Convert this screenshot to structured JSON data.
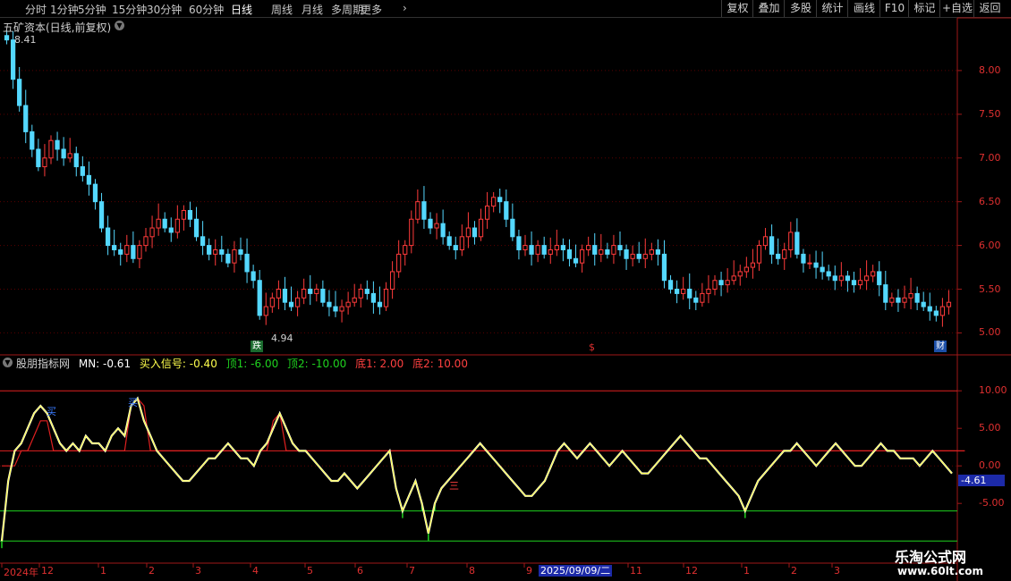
{
  "toolbar": {
    "timeframes": [
      {
        "label": "分时",
        "active": false
      },
      {
        "label": "1分钟",
        "active": false
      },
      {
        "label": "5分钟",
        "active": false
      },
      {
        "label": "15分钟",
        "active": false
      },
      {
        "label": "30分钟",
        "active": false
      },
      {
        "label": "60分钟",
        "active": false
      },
      {
        "label": "日线",
        "active": true
      },
      {
        "label": "周线",
        "active": false
      },
      {
        "label": "月线",
        "active": false
      },
      {
        "label": "多周期",
        "active": false
      },
      {
        "label": "更多",
        "active": false
      }
    ],
    "more_chevron": "chevron-right-icon",
    "right_buttons": [
      "复权",
      "叠加",
      "多股",
      "统计",
      "画线",
      "F10",
      "标记",
      "+自选",
      "返回"
    ]
  },
  "stock_title": "五矿资本(日线,前复权)",
  "price_axis": [
    "8.00",
    "7.50",
    "7.00",
    "6.50",
    "6.00",
    "5.50",
    "5.00"
  ],
  "price_high_label": "8.41",
  "price_low_label": "4.94",
  "markers": {
    "die": "跌",
    "cai": "财",
    "s": "$"
  },
  "indicator": {
    "name": "股朋指标网",
    "mn_label": "MN: -0.61",
    "buy_label": "买入信号: -0.40",
    "top1_label": "顶1: -6.00",
    "top2_label": "顶2: -10.00",
    "bottom1_label": "底1: 2.00",
    "bottom2_label": "底2: 10.00",
    "axis": [
      "10.00",
      "5.00",
      "0.00",
      "-5.00"
    ],
    "current_value": "-4.61",
    "signal_buy": "买",
    "signal_three": "三",
    "hlines": [
      10,
      2,
      -6,
      -10
    ]
  },
  "time_axis": {
    "labels": [
      "2024年",
      "12",
      "1",
      "2",
      "3",
      "4",
      "5",
      "6",
      "7",
      "8",
      "9",
      "11",
      "12",
      "1",
      "2",
      "3"
    ],
    "selected_date": "2025/09/09/二"
  },
  "watermark": {
    "line1": "乐淘公式网",
    "line2": "www.60lt.com"
  },
  "colors": {
    "up": "#ff3b3b",
    "down": "#54d8ff",
    "axis": "#e03030",
    "mn": "#ffff4d",
    "mn2": "#ffffff",
    "bar": "#e02020",
    "green": "#1fd21f"
  },
  "chart_data": {
    "type": "candlestick",
    "price": {
      "ylim": [
        4.8,
        8.5
      ],
      "close": [
        8.35,
        7.9,
        7.6,
        7.3,
        7.1,
        6.9,
        7.0,
        7.2,
        7.1,
        7.0,
        7.05,
        6.9,
        6.8,
        6.7,
        6.5,
        6.2,
        6.0,
        5.95,
        5.9,
        6.0,
        5.85,
        6.0,
        6.1,
        6.2,
        6.3,
        6.2,
        6.15,
        6.3,
        6.4,
        6.3,
        6.1,
        6.0,
        5.9,
        5.95,
        5.9,
        5.8,
        5.95,
        5.9,
        5.7,
        5.6,
        5.2,
        5.3,
        5.4,
        5.5,
        5.35,
        5.3,
        5.4,
        5.5,
        5.45,
        5.5,
        5.35,
        5.3,
        5.25,
        5.3,
        5.35,
        5.4,
        5.5,
        5.45,
        5.35,
        5.3,
        5.5,
        5.7,
        5.9,
        6.0,
        6.3,
        6.5,
        6.3,
        6.2,
        6.25,
        6.1,
        6.0,
        5.95,
        6.1,
        6.2,
        6.1,
        6.3,
        6.45,
        6.55,
        6.5,
        6.3,
        6.1,
        5.95,
        6.0,
        5.9,
        6.0,
        5.9,
        5.95,
        6.0,
        5.95,
        5.85,
        5.8,
        5.95,
        6.0,
        5.9,
        5.95,
        5.9,
        6.0,
        5.95,
        5.85,
        5.9,
        5.85,
        5.9,
        5.95,
        5.9,
        5.6,
        5.5,
        5.45,
        5.5,
        5.4,
        5.35,
        5.45,
        5.5,
        5.6,
        5.55,
        5.6,
        5.65,
        5.7,
        5.75,
        5.8,
        6.0,
        6.1,
        5.9,
        5.85,
        5.95,
        6.15,
        5.9,
        5.8,
        5.8,
        5.75,
        5.7,
        5.65,
        5.6,
        5.65,
        5.6,
        5.55,
        5.6,
        5.65,
        5.7,
        5.55,
        5.35,
        5.4,
        5.35,
        5.4,
        5.45,
        5.35,
        5.3,
        5.25,
        5.2,
        5.3,
        5.35
      ]
    },
    "indicator": {
      "ylim": [
        -12,
        13
      ],
      "mn": [
        -10,
        -2,
        2,
        3,
        5,
        7,
        8,
        7,
        5,
        3,
        2,
        3,
        2,
        4,
        3,
        3,
        2,
        4,
        5,
        4,
        8,
        9,
        6,
        4,
        2,
        1,
        0,
        -1,
        -2,
        -2,
        -1,
        0,
        1,
        1,
        2,
        3,
        2,
        1,
        1,
        0,
        2,
        3,
        5,
        7,
        5,
        3,
        2,
        2,
        1,
        0,
        -1,
        -2,
        -2,
        -1,
        -2,
        -3,
        -2,
        -1,
        0,
        1,
        2,
        -3,
        -6,
        -4,
        -2,
        -5,
        -9,
        -5,
        -3,
        -2,
        -1,
        0,
        1,
        2,
        3,
        2,
        1,
        0,
        -1,
        -2,
        -3,
        -4,
        -4,
        -3,
        -2,
        0,
        2,
        3,
        2,
        1,
        2,
        3,
        2,
        1,
        0,
        1,
        2,
        1,
        0,
        -1,
        -1,
        0,
        1,
        2,
        3,
        4,
        3,
        2,
        1,
        1,
        0,
        -1,
        -2,
        -3,
        -4,
        -6,
        -4,
        -2,
        -1,
        0,
        1,
        2,
        2,
        3,
        2,
        1,
        0,
        1,
        2,
        3,
        2,
        1,
        0,
        0,
        1,
        2,
        3,
        2,
        2,
        1,
        1,
        1,
        0,
        1,
        2,
        1,
        0,
        -1
      ],
      "bars": [
        0,
        0,
        0,
        2,
        2,
        4,
        6,
        6,
        2,
        2,
        2,
        2,
        2,
        2,
        2,
        2,
        2,
        2,
        2,
        2,
        8,
        9,
        8,
        2,
        2,
        2,
        2,
        2,
        2,
        2,
        2,
        2,
        2,
        2,
        2,
        2,
        2,
        2,
        2,
        2,
        2,
        2,
        6,
        7,
        2,
        2,
        2,
        2,
        2,
        2,
        2,
        2,
        2,
        2,
        2,
        2,
        2,
        2,
        2,
        2,
        2,
        2,
        2,
        2,
        2,
        2,
        2,
        2,
        2,
        2,
        2,
        2,
        2,
        2,
        2,
        2,
        2,
        2,
        2,
        2,
        2,
        2,
        2,
        2,
        2,
        2,
        2,
        2,
        2,
        2,
        2,
        2,
        2,
        2,
        2,
        2,
        2,
        2,
        2,
        2,
        2,
        2,
        2,
        2,
        2,
        2,
        2,
        2,
        2,
        2,
        2,
        2,
        2,
        2,
        2,
        2,
        2,
        2,
        2,
        2,
        2,
        2,
        2,
        2,
        2,
        2,
        2,
        2,
        2,
        2,
        2,
        2,
        2,
        2,
        2,
        2,
        2,
        2,
        2,
        2,
        2,
        2,
        2,
        2,
        2,
        2,
        2,
        2,
        2,
        2
      ]
    }
  }
}
